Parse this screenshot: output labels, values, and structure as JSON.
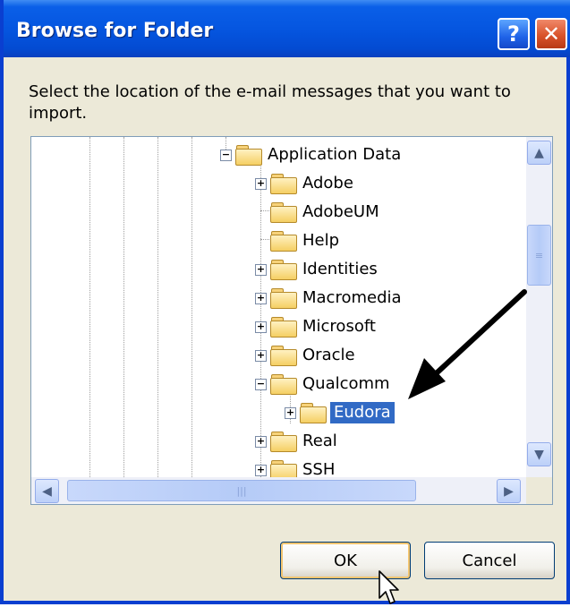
{
  "window": {
    "title": "Browse for Folder",
    "help_label": "?",
    "close_label": "✕"
  },
  "prompt": "Select the location of the e-mail messages that you want to import.",
  "tree": {
    "items": [
      {
        "label": "Application Data",
        "expander": "−",
        "icon": "folder-open-icon"
      },
      {
        "label": "Adobe",
        "expander": "+",
        "icon": "folder-icon"
      },
      {
        "label": "AdobeUM",
        "expander": "",
        "icon": "folder-icon"
      },
      {
        "label": "Help",
        "expander": "",
        "icon": "folder-icon"
      },
      {
        "label": "Identities",
        "expander": "+",
        "icon": "folder-icon"
      },
      {
        "label": "Macromedia",
        "expander": "+",
        "icon": "folder-icon"
      },
      {
        "label": "Microsoft",
        "expander": "+",
        "icon": "folder-icon"
      },
      {
        "label": "Oracle",
        "expander": "+",
        "icon": "folder-icon"
      },
      {
        "label": "Qualcomm",
        "expander": "−",
        "icon": "folder-open-icon"
      },
      {
        "label": "Eudora",
        "expander": "+",
        "icon": "folder-open-icon",
        "selected": true
      },
      {
        "label": "Real",
        "expander": "+",
        "icon": "folder-icon"
      },
      {
        "label": "SSH",
        "expander": "+",
        "icon": "folder-icon"
      }
    ]
  },
  "buttons": {
    "ok": "OK",
    "cancel": "Cancel"
  },
  "colors": {
    "titlebar": "#0556e0",
    "selection": "#316ac5",
    "dialog_bg": "#ece9d8"
  }
}
